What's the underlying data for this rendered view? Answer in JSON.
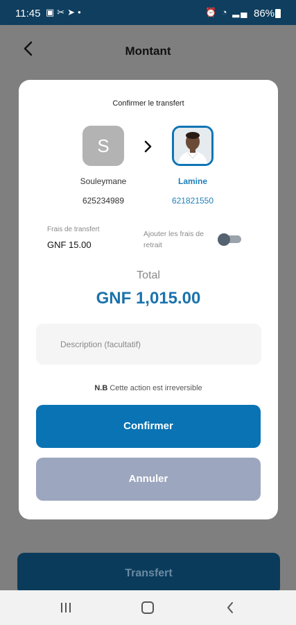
{
  "status_bar": {
    "time": "11:45",
    "battery": "86%"
  },
  "header": {
    "title": "Montant"
  },
  "modal": {
    "title": "Confirmer le transfert",
    "sender": {
      "initial": "S",
      "name": "Souleymane",
      "phone": "625234989"
    },
    "receiver": {
      "name": "Lamine",
      "phone": "621821550"
    },
    "fee": {
      "label": "Frais de transfert",
      "value": "GNF 15.00"
    },
    "withdraw_toggle": {
      "label": "Ajouter les frais de retrait",
      "enabled": false
    },
    "total": {
      "label": "Total",
      "value": "GNF 1,015.00"
    },
    "description": {
      "placeholder": "Description (facultatif)",
      "value": ""
    },
    "note": {
      "prefix": "N.B",
      "text": "Cette action est irreversible"
    },
    "confirm_label": "Confirmer",
    "cancel_label": "Annuler"
  },
  "footer": {
    "transfer_label": "Transfert"
  },
  "colors": {
    "accent": "#0a73b3",
    "cancel": "#9ca6be",
    "status_bar": "#0f3e5e"
  }
}
